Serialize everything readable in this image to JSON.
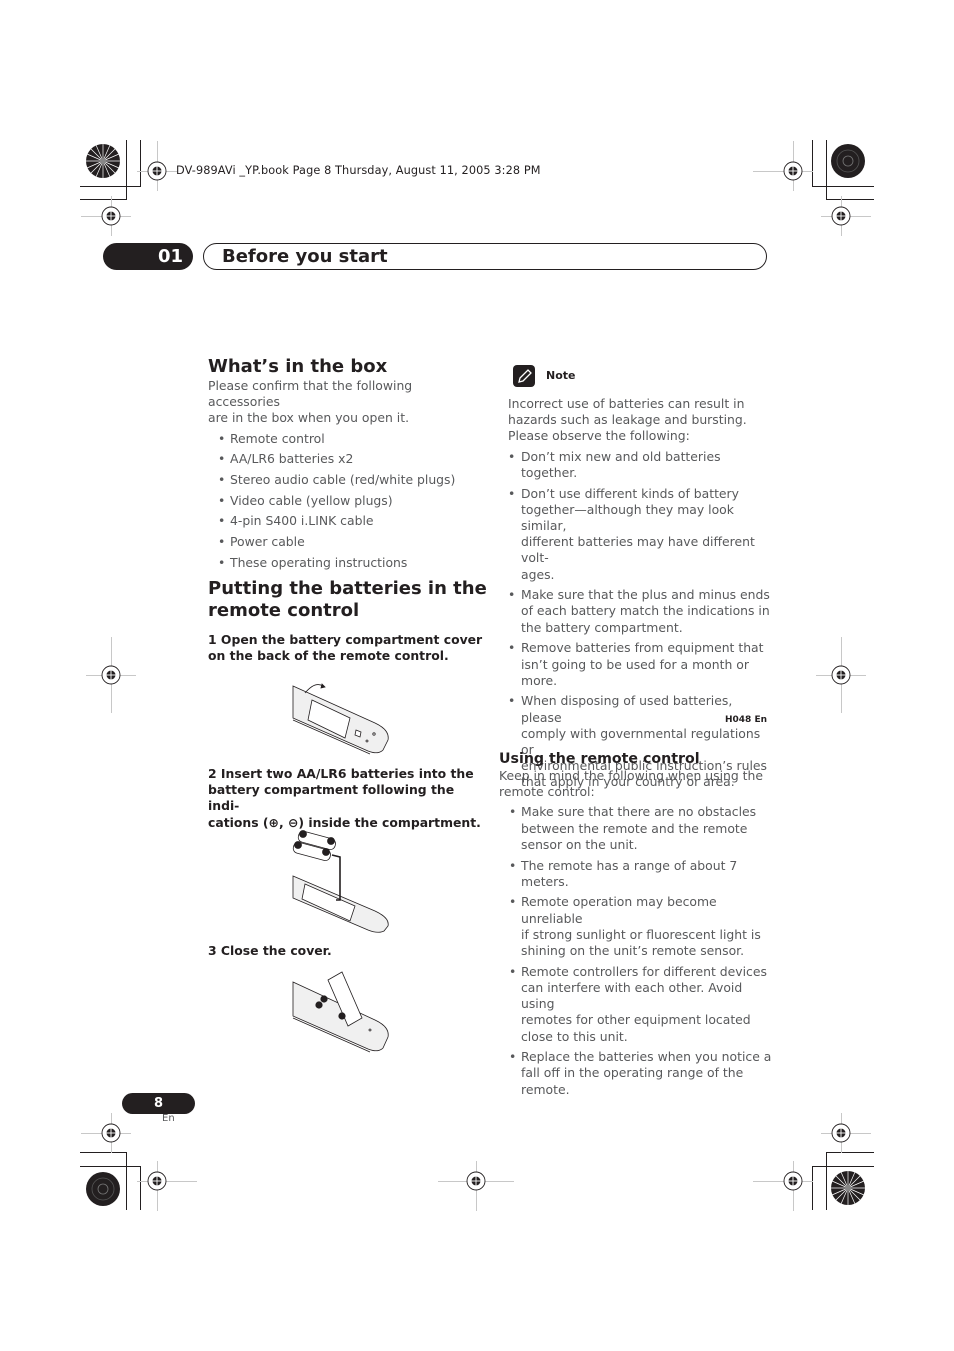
{
  "book_header": "DV-989AVi _YP.book  Page 8  Thursday, August 11, 2005  3:28 PM",
  "chapter": {
    "number": "01",
    "title": "Before you start"
  },
  "whats_in_box": {
    "heading": "What’s in the box",
    "intro_lines": [
      "Please confirm that the following accessories",
      "are in the box when you open it."
    ],
    "items": [
      "Remote control",
      "AA/LR6 batteries x2",
      "Stereo audio cable (red/white plugs)",
      "Video cable (yellow plugs)",
      "4-pin S400 i.LINK cable",
      "Power cable",
      "These operating instructions"
    ]
  },
  "batteries": {
    "heading_lines": [
      "Putting the batteries in the",
      "remote control"
    ],
    "steps": [
      {
        "lines": [
          "1    Open the battery compartment cover",
          "on the back of the remote control."
        ],
        "illustration": "remote-cover-open-illustration"
      },
      {
        "lines": [
          "2    Insert two AA/LR6 batteries into the",
          "battery compartment following the indi-",
          "cations (⊕, ⊖) inside the compartment."
        ],
        "illustration": "insert-batteries-illustration"
      },
      {
        "lines": [
          "3    Close the cover."
        ],
        "illustration": "close-cover-illustration"
      }
    ]
  },
  "note": {
    "label": "Note",
    "intro_lines": [
      "Incorrect use of batteries can result in",
      "hazards such as leakage and bursting.",
      "Please observe the following:"
    ],
    "items": [
      [
        "Don’t mix new and old batteries together."
      ],
      [
        "Don’t use different kinds of battery",
        "together—although they may look similar,",
        "different batteries may have different volt-",
        "ages."
      ],
      [
        "Make sure that the plus and minus ends",
        "of each battery match the indications in",
        "the battery compartment."
      ],
      [
        "Remove batteries from equipment that",
        "isn’t going to be used for a month or",
        "more."
      ],
      [
        "When disposing of used batteries, please",
        "comply with governmental regulations or",
        "environmental public instruction’s rules",
        "that apply in your country or area."
      ]
    ],
    "code": "H048 En"
  },
  "using_remote": {
    "heading": "Using the remote control",
    "intro_lines": [
      "Keep in mind the following when using the",
      "remote control:"
    ],
    "items": [
      [
        "Make sure that there are no obstacles",
        "between the remote and the remote",
        "sensor on the unit."
      ],
      [
        "The remote has a range of about 7 meters."
      ],
      [
        "Remote operation may become unreliable",
        "if strong sunlight or fluorescent light is",
        "shining on the unit’s remote sensor."
      ],
      [
        "Remote controllers for different devices",
        "can interfere with each other. Avoid using",
        "remotes for other equipment located",
        "close to this unit."
      ],
      [
        "Replace the batteries when you notice a",
        "fall off in the operating range of the",
        "remote."
      ]
    ]
  },
  "footer": {
    "page_number": "8",
    "language": "En"
  },
  "bullet": "•"
}
